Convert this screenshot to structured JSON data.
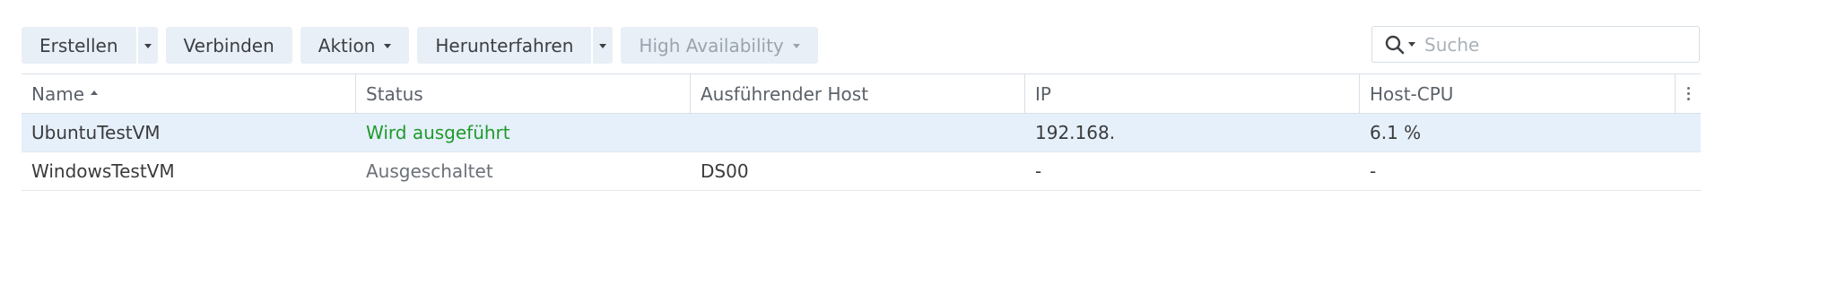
{
  "toolbar": {
    "create_label": "Erstellen",
    "connect_label": "Verbinden",
    "action_label": "Aktion",
    "shutdown_label": "Herunterfahren",
    "ha_label": "High Availability"
  },
  "search": {
    "placeholder": "Suche",
    "value": ""
  },
  "table": {
    "columns": [
      "Name",
      "Status",
      "Ausführender Host",
      "IP",
      "Host-CPU"
    ],
    "sort": {
      "column": "Name",
      "direction": "asc"
    },
    "rows": [
      {
        "name": "UbuntuTestVM",
        "status": "Wird ausgeführt",
        "host": "",
        "ip": "192.168.",
        "cpu": "6.1 %",
        "selected": true
      },
      {
        "name": "WindowsTestVM",
        "status": "Ausgeschaltet",
        "host": "DS00",
        "ip": "-",
        "cpu": "-",
        "selected": false
      }
    ]
  },
  "colors": {
    "button_bg": "#e9eff6",
    "selected_row": "#e6f0fb",
    "running": "#1f9a2b",
    "disabled_text": "#9aa4ae"
  },
  "icons": {
    "search": "search-icon",
    "sort": "sort-ascending-icon",
    "column_menu": "more-vertical-icon",
    "dropdown": "chevron-down-icon"
  }
}
